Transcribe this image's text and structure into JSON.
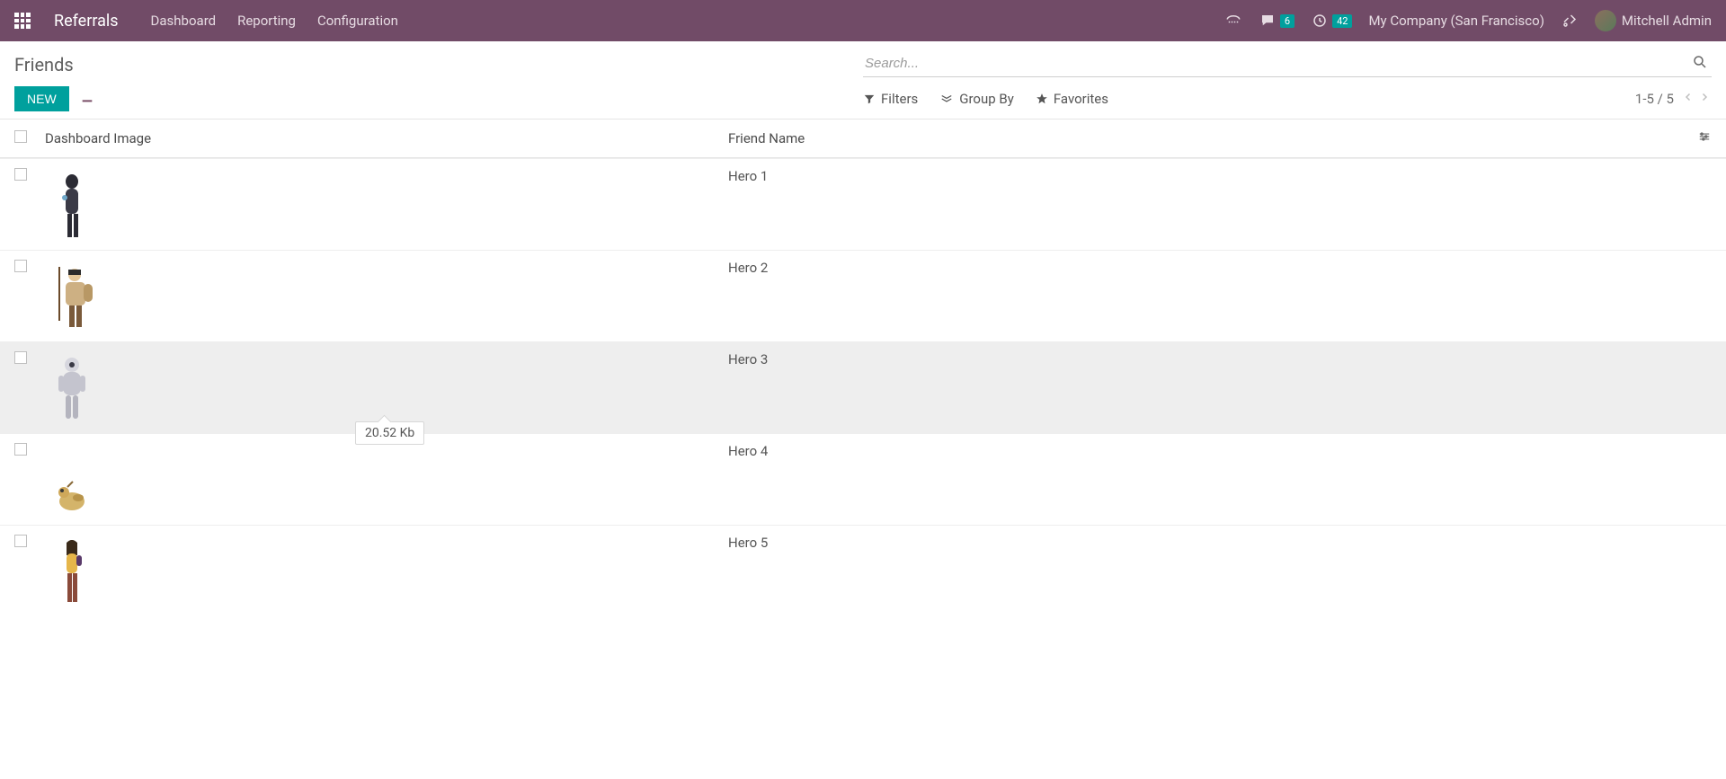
{
  "navbar": {
    "brand": "Referrals",
    "menu": [
      {
        "label": "Dashboard"
      },
      {
        "label": "Reporting"
      },
      {
        "label": "Configuration"
      }
    ],
    "messages_badge": "6",
    "activities_badge": "42",
    "company": "My Company (San Francisco)",
    "user_name": "Mitchell Admin"
  },
  "control_panel": {
    "title": "Friends",
    "new_label": "NEW",
    "search_placeholder": "Search...",
    "filters_label": "Filters",
    "groupby_label": "Group By",
    "favorites_label": "Favorites",
    "pager": "1-5 / 5"
  },
  "table": {
    "header_image": "Dashboard Image",
    "header_name": "Friend Name",
    "rows": [
      {
        "name": "Hero 1"
      },
      {
        "name": "Hero 2"
      },
      {
        "name": "Hero 3"
      },
      {
        "name": "Hero 4"
      },
      {
        "name": "Hero 5"
      }
    ],
    "hovered_index": 2,
    "tooltip_text": "20.52 Kb",
    "tooltip_row_index": 3
  }
}
